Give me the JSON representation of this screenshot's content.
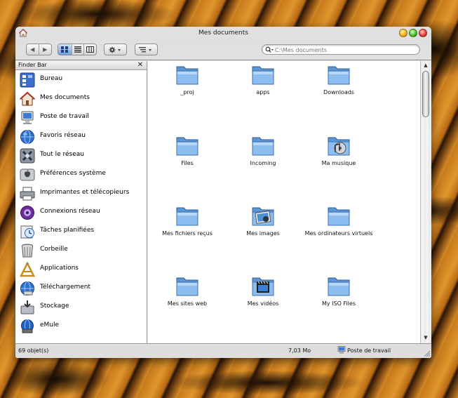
{
  "window": {
    "title": "Mes documents"
  },
  "toolbar": {
    "back_label": "◀",
    "forward_label": "▶",
    "search_placeholder": "C:\\Mes documents"
  },
  "sidebar": {
    "header": "Finder Bar",
    "close_label": "✕",
    "items": [
      {
        "label": "Bureau",
        "icon": "desktop-icon"
      },
      {
        "label": "Mes documents",
        "icon": "home-icon"
      },
      {
        "label": "Poste de travail",
        "icon": "computer-icon"
      },
      {
        "label": "Favoris réseau",
        "icon": "network-globe-icon"
      },
      {
        "label": "Tout le réseau",
        "icon": "network-x-icon"
      },
      {
        "label": "Préférences système",
        "icon": "system-preferences-icon"
      },
      {
        "label": "Imprimantes et télécopieurs",
        "icon": "printer-icon"
      },
      {
        "label": "Connexions réseau",
        "icon": "network-connections-icon"
      },
      {
        "label": "Tâches planifiées",
        "icon": "scheduled-tasks-icon"
      },
      {
        "label": "Corbeille",
        "icon": "trash-icon"
      },
      {
        "label": "Applications",
        "icon": "applications-icon"
      },
      {
        "label": "Téléchargement",
        "icon": "download-icon"
      },
      {
        "label": "Stockage",
        "icon": "storage-icon"
      },
      {
        "label": "eMule",
        "icon": "emule-icon"
      }
    ]
  },
  "files": [
    {
      "label": "_proj",
      "icon": "folder-icon"
    },
    {
      "label": "apps",
      "icon": "folder-icon"
    },
    {
      "label": "Downloads",
      "icon": "folder-icon"
    },
    {
      "label": "Files",
      "icon": "folder-icon"
    },
    {
      "label": "Incoming",
      "icon": "folder-icon"
    },
    {
      "label": "Ma musique",
      "icon": "music-folder-icon"
    },
    {
      "label": "Mes fichiers reçus",
      "icon": "folder-icon"
    },
    {
      "label": "Mes images",
      "icon": "pictures-folder-icon"
    },
    {
      "label": "Mes ordinateurs virtuels",
      "icon": "folder-icon"
    },
    {
      "label": "Mes sites web",
      "icon": "folder-icon"
    },
    {
      "label": "Mes vidéos",
      "icon": "videos-folder-icon"
    },
    {
      "label": "My ISO Files",
      "icon": "folder-icon"
    }
  ],
  "status": {
    "count": "69 objet(s)",
    "size": "7,03 Mo",
    "location": "Poste de travail"
  },
  "colors": {
    "folder": "#7fb3e8",
    "traffic_close": "#e8423a",
    "traffic_min": "#f2b21e",
    "traffic_zoom": "#4fbf2a"
  }
}
